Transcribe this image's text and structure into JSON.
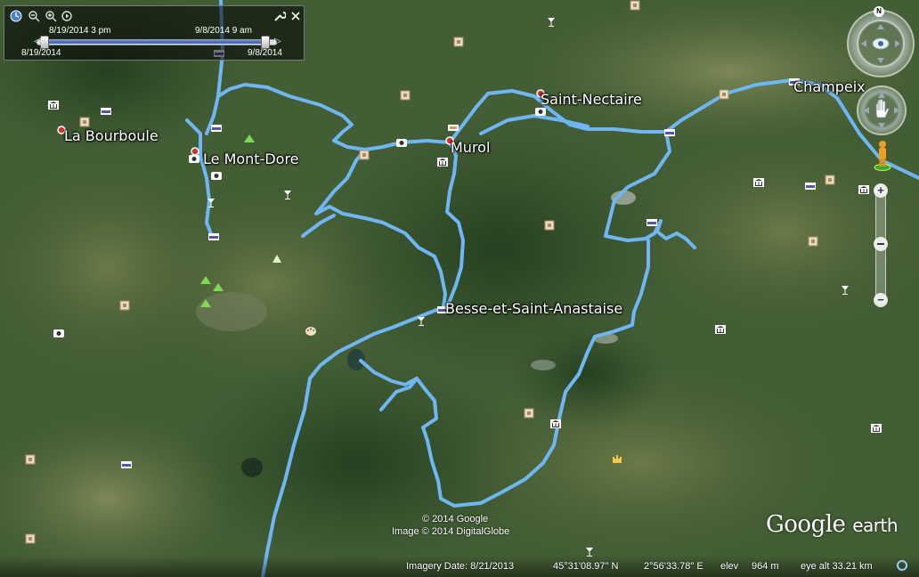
{
  "colors": {
    "route": "#6fb7f4",
    "label_text": "#ffffff",
    "terrain_dark": "#2f4a27",
    "terrain_light": "#6a7c45"
  },
  "time_slider": {
    "start_label": "8/19/2014",
    "start_time_label": "8/19/2014   3 pm",
    "end_time_label": "9/8/2014   9 am",
    "end_label": "9/8/2014",
    "icons": [
      "clock-icon",
      "zoom-out-icon",
      "zoom-in-icon",
      "play-icon",
      "wrench-icon",
      "close-icon"
    ]
  },
  "places": [
    {
      "name": "La Bourboule"
    },
    {
      "name": "Le Mont-Dore"
    },
    {
      "name": "Saint-Nectaire"
    },
    {
      "name": "Murol"
    },
    {
      "name": "Champeix"
    },
    {
      "name": "Besse-et-Saint-Anastaise"
    }
  ],
  "navigation": {
    "north_label": "N",
    "zoom_in": "+",
    "zoom_out": "−"
  },
  "credits": {
    "copyright": "© 2014 Google",
    "imagery": "Image © 2014 DigitalGlobe",
    "logo_main": "Google",
    "logo_sub": "earth"
  },
  "status": {
    "imagery_date": "Imagery Date: 8/21/2013",
    "latitude": "45°31'08.97\" N",
    "longitude": "2°56'33.78\" E",
    "elev_label": "elev",
    "elev_value": "964 m",
    "eye_alt": "eye alt  33.21 km"
  }
}
